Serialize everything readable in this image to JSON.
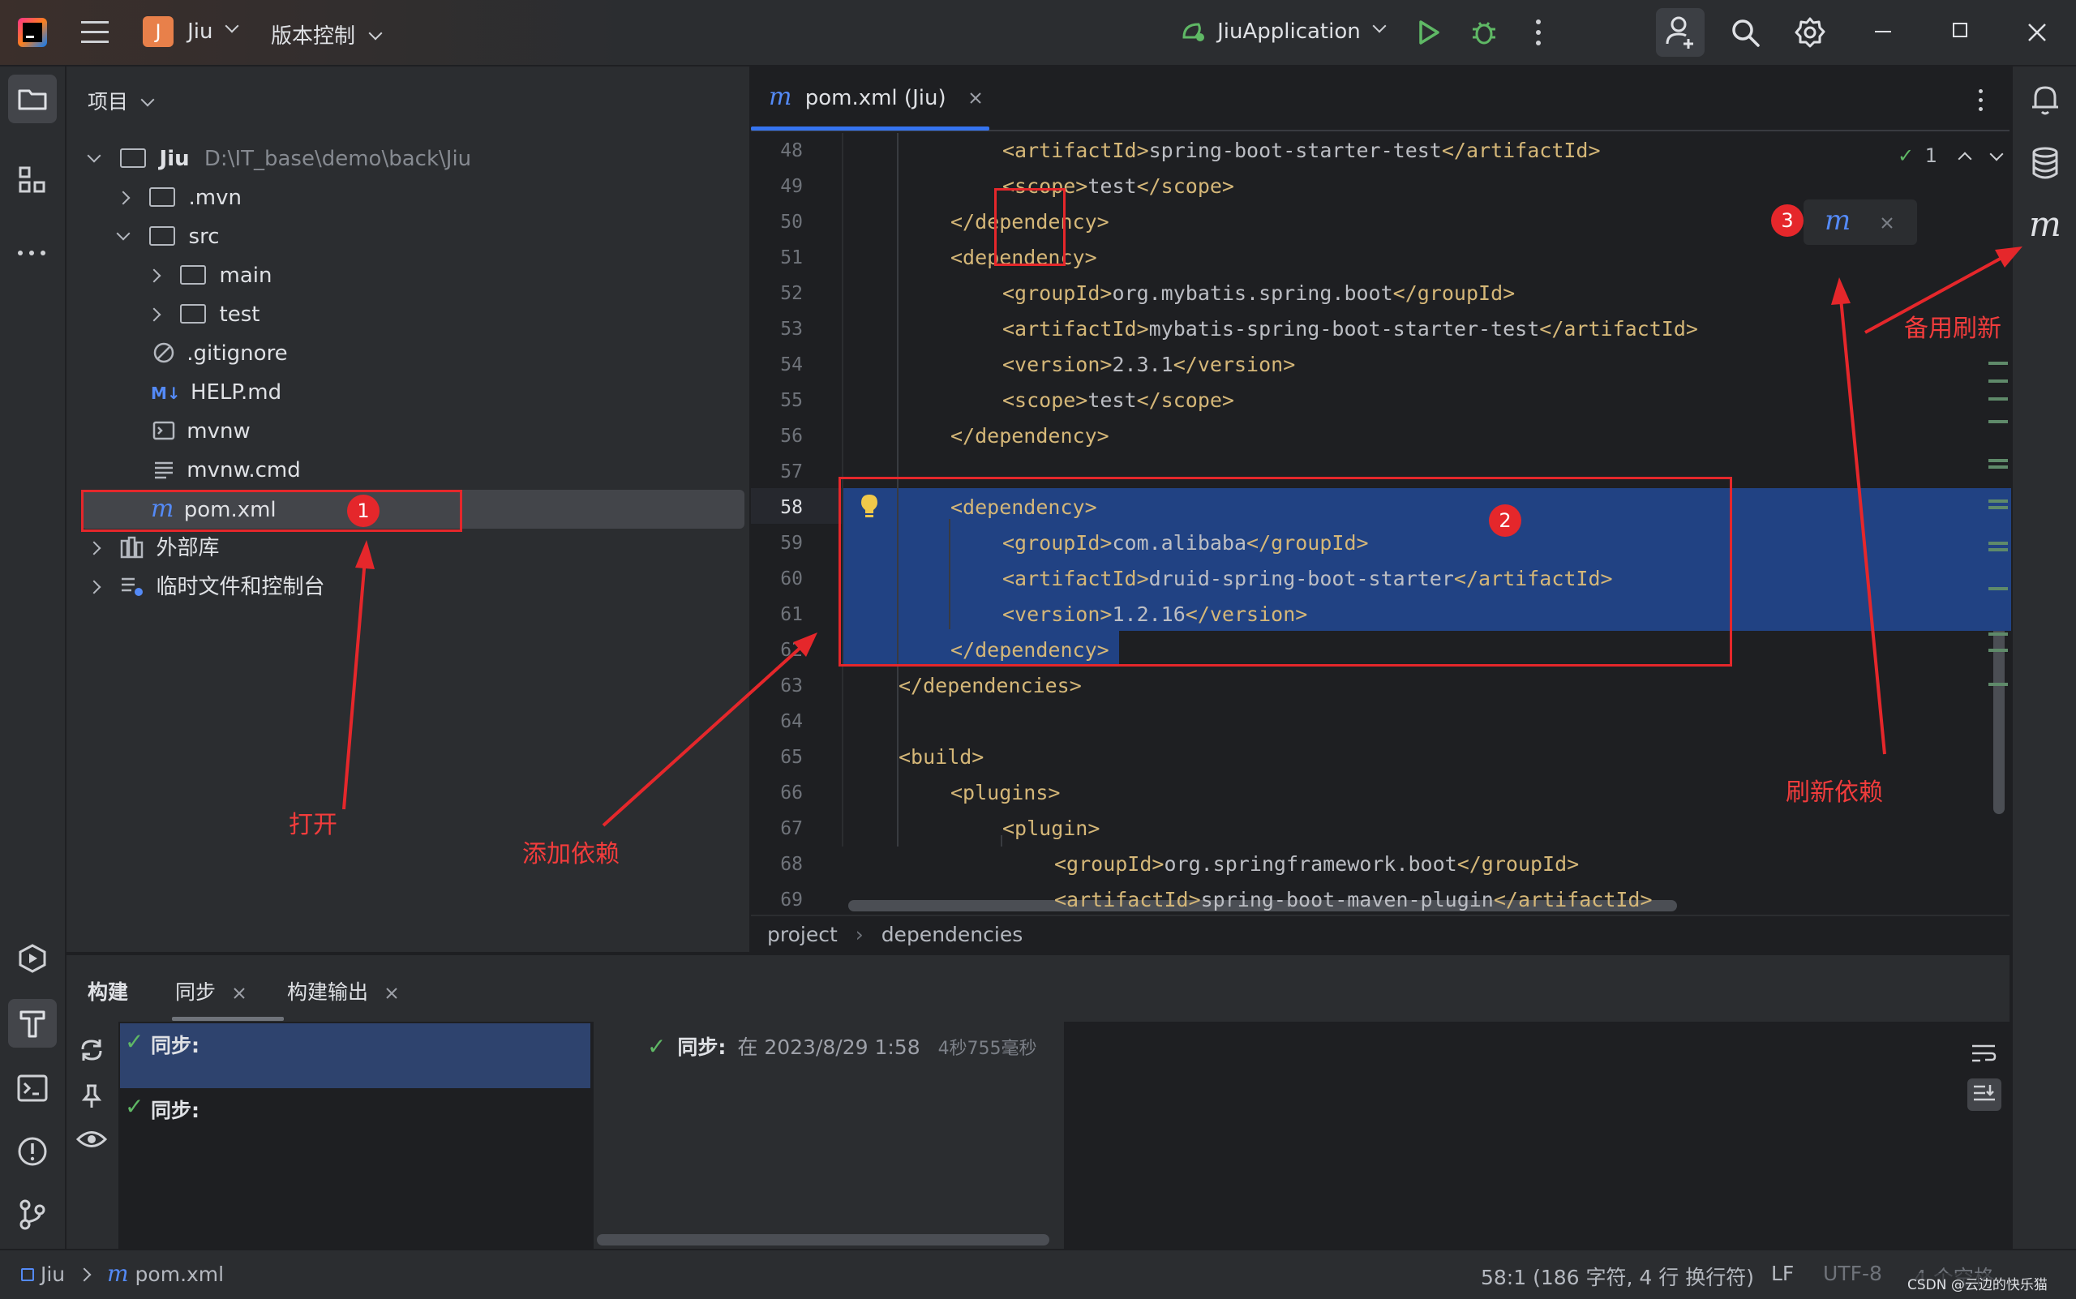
{
  "titlebar": {
    "project_initial": "J",
    "project_name": "Jiu",
    "vcs_label": "版本控制",
    "run_config": "JiuApplication"
  },
  "project_panel": {
    "title": "项目",
    "tree": [
      {
        "label": "Jiu",
        "path": "D:\\IT_base\\demo\\back\\Jiu"
      },
      {
        "label": ".mvn"
      },
      {
        "label": "src"
      },
      {
        "label": "main"
      },
      {
        "label": "test"
      },
      {
        "label": ".gitignore"
      },
      {
        "label": "HELP.md",
        "icon_text": "M↓"
      },
      {
        "label": "mvnw"
      },
      {
        "label": "mvnw.cmd"
      },
      {
        "label": "pom.xml"
      },
      {
        "label": "外部库"
      },
      {
        "label": "临时文件和控制台"
      }
    ]
  },
  "editor": {
    "tab_label": "pom.xml (Jiu)",
    "inspection_count": "1",
    "breadcrumb": [
      "project",
      "dependencies"
    ],
    "lines": [
      {
        "n": "48",
        "indent": 3,
        "parts": [
          [
            "t",
            "<artifactId>"
          ],
          [
            "x",
            "spring-boot-starter-test"
          ],
          [
            "t",
            "</artifactId>"
          ]
        ]
      },
      {
        "n": "49",
        "indent": 3,
        "parts": [
          [
            "t",
            "<scope>"
          ],
          [
            "x",
            "test"
          ],
          [
            "t",
            "</scope>"
          ]
        ]
      },
      {
        "n": "50",
        "indent": 2,
        "parts": [
          [
            "t",
            "</dependency>"
          ]
        ]
      },
      {
        "n": "51",
        "indent": 2,
        "parts": [
          [
            "t",
            "<dependency>"
          ]
        ]
      },
      {
        "n": "52",
        "indent": 3,
        "parts": [
          [
            "t",
            "<groupId>"
          ],
          [
            "x",
            "org.mybatis.spring.boot"
          ],
          [
            "t",
            "</groupId>"
          ]
        ]
      },
      {
        "n": "53",
        "indent": 3,
        "parts": [
          [
            "t",
            "<artifactId>"
          ],
          [
            "x",
            "mybatis-spring-boot-starter-test"
          ],
          [
            "t",
            "</artifactId>"
          ]
        ]
      },
      {
        "n": "54",
        "indent": 3,
        "parts": [
          [
            "t",
            "<version>"
          ],
          [
            "x",
            "2.3.1"
          ],
          [
            "t",
            "</version>"
          ]
        ]
      },
      {
        "n": "55",
        "indent": 3,
        "parts": [
          [
            "t",
            "<scope>"
          ],
          [
            "x",
            "test"
          ],
          [
            "t",
            "</scope>"
          ]
        ]
      },
      {
        "n": "56",
        "indent": 2,
        "parts": [
          [
            "t",
            "</dependency>"
          ]
        ]
      },
      {
        "n": "57",
        "indent": 0,
        "parts": []
      },
      {
        "n": "58",
        "indent": 2,
        "parts": [
          [
            "t",
            "<dependency>"
          ]
        ]
      },
      {
        "n": "59",
        "indent": 3,
        "parts": [
          [
            "t",
            "<groupId>"
          ],
          [
            "x",
            "com.alibaba"
          ],
          [
            "t",
            "</groupId>"
          ]
        ]
      },
      {
        "n": "60",
        "indent": 3,
        "parts": [
          [
            "t",
            "<artifactId>"
          ],
          [
            "x",
            "druid-spring-boot-starter"
          ],
          [
            "t",
            "</artifactId>"
          ]
        ]
      },
      {
        "n": "61",
        "indent": 3,
        "parts": [
          [
            "t",
            "<version>"
          ],
          [
            "x",
            "1.2.16"
          ],
          [
            "t",
            "</version>"
          ]
        ]
      },
      {
        "n": "62",
        "indent": 2,
        "parts": [
          [
            "t",
            "</dependency>"
          ]
        ]
      },
      {
        "n": "63",
        "indent": 1,
        "parts": [
          [
            "t",
            "</dependencies>"
          ]
        ]
      },
      {
        "n": "64",
        "indent": 0,
        "parts": []
      },
      {
        "n": "65",
        "indent": 1,
        "parts": [
          [
            "t",
            "<build>"
          ]
        ]
      },
      {
        "n": "66",
        "indent": 2,
        "parts": [
          [
            "t",
            "<plugins>"
          ]
        ]
      },
      {
        "n": "67",
        "indent": 3,
        "parts": [
          [
            "t",
            "<plugin>"
          ]
        ]
      },
      {
        "n": "68",
        "indent": 4,
        "parts": [
          [
            "t",
            "<groupId>"
          ],
          [
            "x",
            "org.springframework.boot"
          ],
          [
            "t",
            "</groupId>"
          ]
        ]
      },
      {
        "n": "69",
        "indent": 4,
        "parts": [
          [
            "t",
            "<artifactId>"
          ],
          [
            "x",
            "spring-boot-maven-plugin"
          ],
          [
            "t",
            "</artifactId>"
          ]
        ]
      }
    ]
  },
  "annotations": {
    "label_open": "打开",
    "label_add": "添加依赖",
    "label_refresh": "刷新依赖",
    "label_backup": "备用刷新",
    "badge1": "1",
    "badge2": "2",
    "badge3": "3"
  },
  "build_panel": {
    "tabs": [
      "构建",
      "同步",
      "构建输出"
    ],
    "tree_items": [
      "同步:",
      "同步:"
    ],
    "result_label": "同步:",
    "result_time": "在 2023/8/29 1:58",
    "result_duration": "4秒755毫秒"
  },
  "statusbar": {
    "project": "Jiu",
    "file": "pom.xml",
    "position": "58:1 (186 字符, 4 行 换行符)",
    "line_sep": "LF",
    "encoding": "UTF-8",
    "indent": "4 个空格",
    "watermark": "CSDN @云边的快乐猫"
  },
  "colors": {
    "accent": "#3574f0",
    "selection": "#214283",
    "annotation": "#e5272b",
    "tag": "#d5b778",
    "run_green": "#5fb865"
  }
}
